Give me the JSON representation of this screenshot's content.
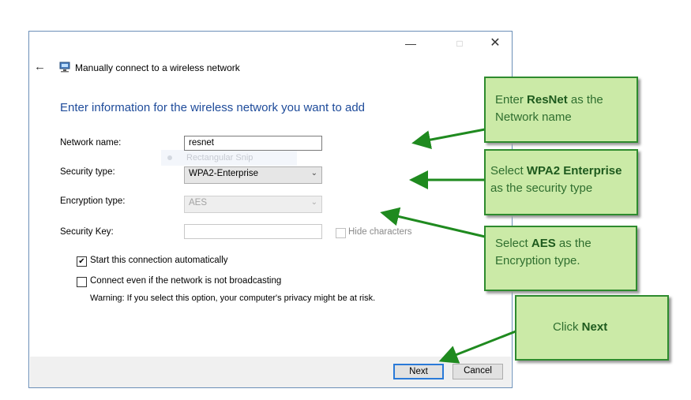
{
  "window": {
    "title": "Manually connect to a wireless network",
    "heading": "Enter information for the wireless network you want to add",
    "controls": {
      "minimize": "—",
      "maximize": "□",
      "close": "✕"
    },
    "back": "←"
  },
  "form": {
    "network_name": {
      "label": "Network name:",
      "value": "resnet"
    },
    "security_type": {
      "label": "Security type:",
      "value": "WPA2-Enterprise"
    },
    "encryption_type": {
      "label": "Encryption type:",
      "value": "AES"
    },
    "security_key": {
      "label": "Security Key:",
      "value": ""
    },
    "hide_characters": {
      "label": "Hide characters",
      "checked": false
    },
    "dropdown_glyph": "⌄"
  },
  "tooltip": {
    "text": "Rectangular Snip"
  },
  "options": {
    "start_auto": {
      "label": "Start this connection automatically",
      "checked": true,
      "mark": "✔"
    },
    "not_broadcasting": {
      "label": "Connect even if the network is not broadcasting",
      "checked": false
    },
    "warning": "Warning: If you select this option, your computer's privacy might be at risk."
  },
  "buttons": {
    "next": "Next",
    "cancel": "Cancel"
  },
  "callouts": {
    "c1": {
      "pre": "Enter ",
      "bold": "ResNet",
      "post": " as the Network name"
    },
    "c2": {
      "pre": "Select ",
      "bold": "WPA2 Enterprise",
      "post": " as the security type"
    },
    "c3": {
      "pre": "Select ",
      "bold": "AES",
      "post": " as the Encryption type."
    },
    "c4": {
      "pre": "Click ",
      "bold": "Next",
      "post": ""
    }
  },
  "colors": {
    "callout_fill": "#cbeaa7",
    "callout_border": "#2e8b2e",
    "arrow": "#1f8a1f",
    "heading": "#1e4b9a",
    "window_border": "#6b8fb8"
  }
}
